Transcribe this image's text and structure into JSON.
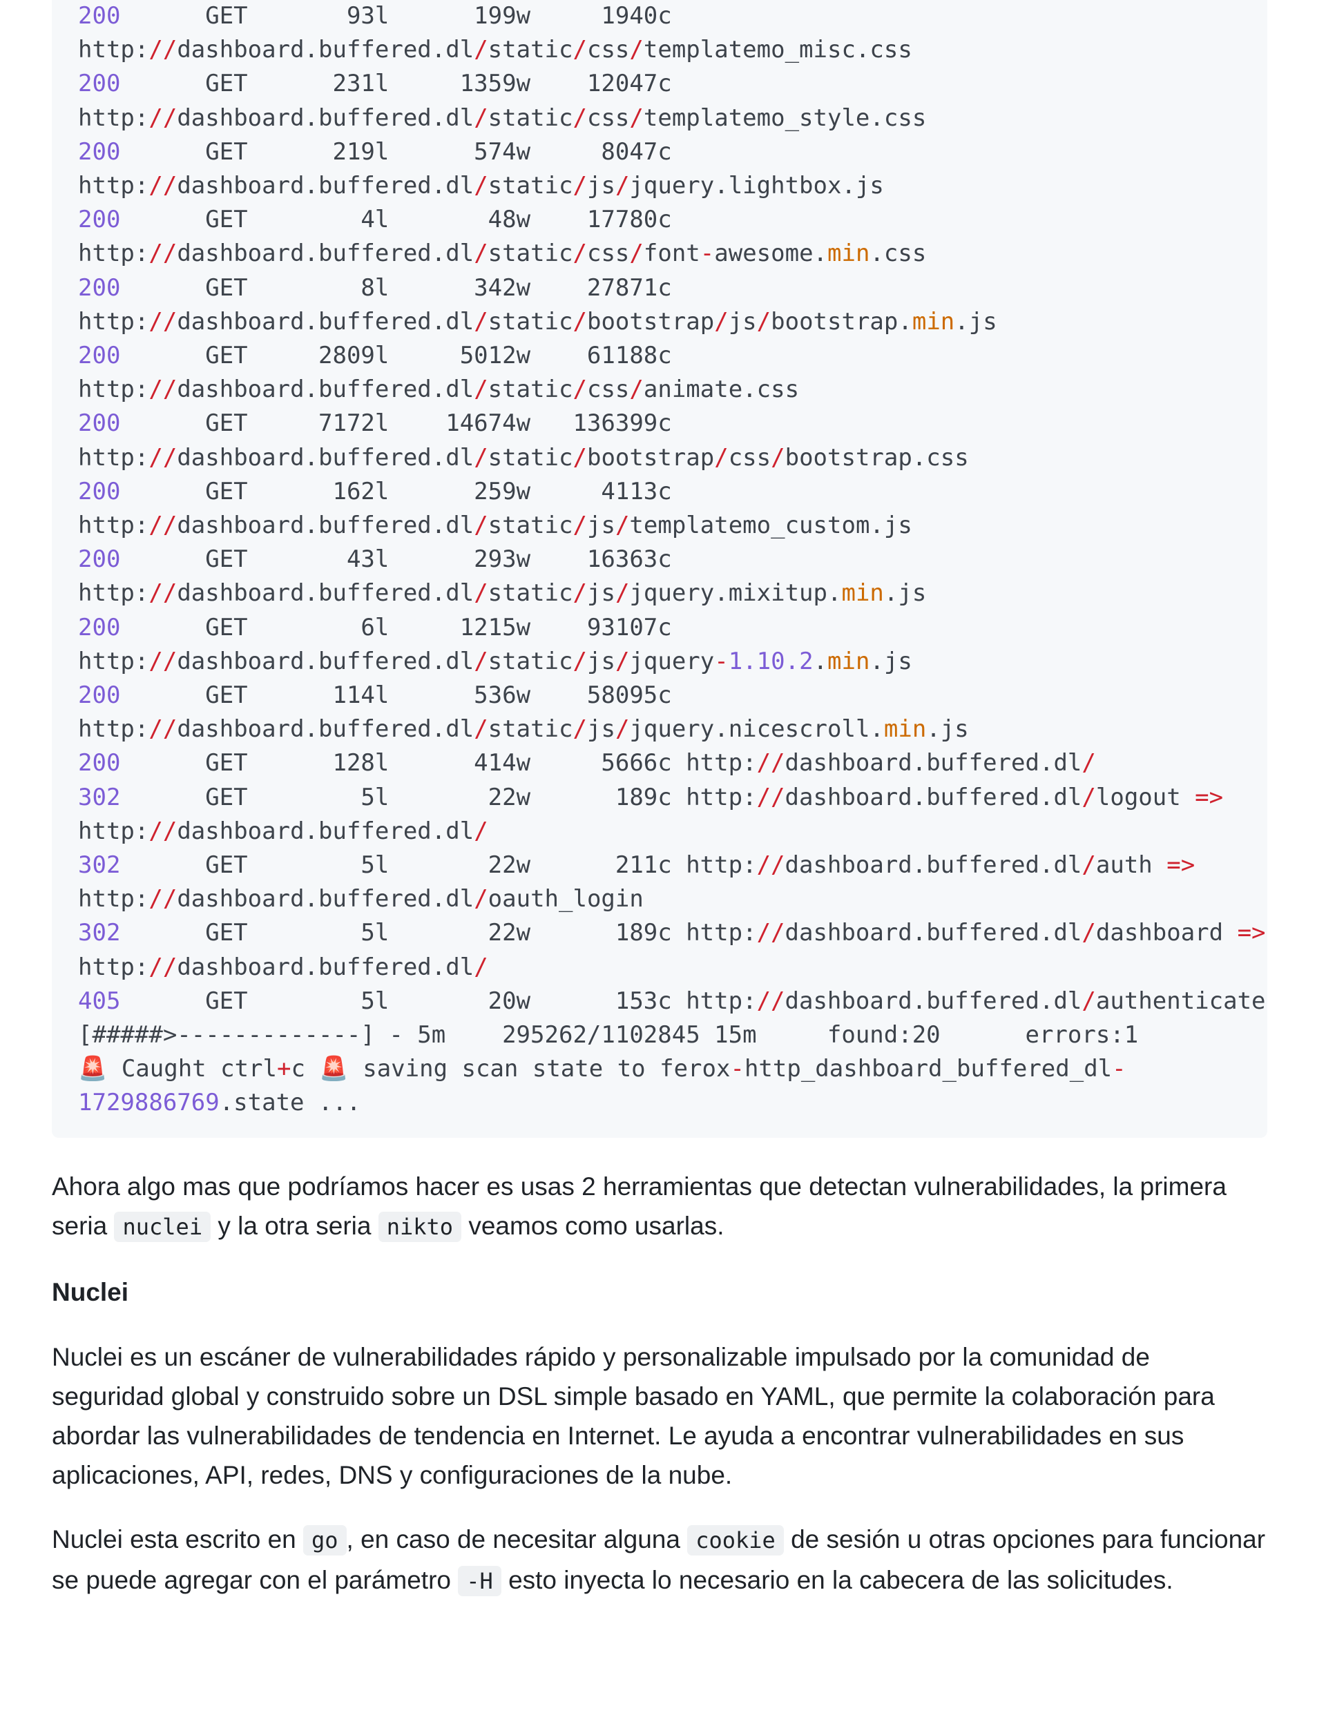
{
  "terminal_output": {
    "lines": [
      [
        {
          "t": "200",
          "c": "num"
        },
        {
          "t": "      GET       93l      199w     1940c"
        }
      ],
      [
        {
          "t": "http:"
        },
        {
          "t": "//",
          "c": "op"
        },
        {
          "t": "dashboard.buffered.dl"
        },
        {
          "t": "/",
          "c": "op"
        },
        {
          "t": "static"
        },
        {
          "t": "/",
          "c": "op"
        },
        {
          "t": "css"
        },
        {
          "t": "/",
          "c": "op"
        },
        {
          "t": "templatemo_misc.css"
        }
      ],
      [
        {
          "t": "200",
          "c": "num"
        },
        {
          "t": "      GET      231l     1359w    12047c"
        }
      ],
      [
        {
          "t": "http:"
        },
        {
          "t": "//",
          "c": "op"
        },
        {
          "t": "dashboard.buffered.dl"
        },
        {
          "t": "/",
          "c": "op"
        },
        {
          "t": "static"
        },
        {
          "t": "/",
          "c": "op"
        },
        {
          "t": "css"
        },
        {
          "t": "/",
          "c": "op"
        },
        {
          "t": "templatemo_style.css"
        }
      ],
      [
        {
          "t": "200",
          "c": "num"
        },
        {
          "t": "      GET      219l      574w     8047c"
        }
      ],
      [
        {
          "t": "http:"
        },
        {
          "t": "//",
          "c": "op"
        },
        {
          "t": "dashboard.buffered.dl"
        },
        {
          "t": "/",
          "c": "op"
        },
        {
          "t": "static"
        },
        {
          "t": "/",
          "c": "op"
        },
        {
          "t": "js"
        },
        {
          "t": "/",
          "c": "op"
        },
        {
          "t": "jquery.lightbox.js"
        }
      ],
      [
        {
          "t": "200",
          "c": "num"
        },
        {
          "t": "      GET        4l       48w    17780c"
        }
      ],
      [
        {
          "t": "http:"
        },
        {
          "t": "//",
          "c": "op"
        },
        {
          "t": "dashboard.buffered.dl"
        },
        {
          "t": "/",
          "c": "op"
        },
        {
          "t": "static"
        },
        {
          "t": "/",
          "c": "op"
        },
        {
          "t": "css"
        },
        {
          "t": "/",
          "c": "op"
        },
        {
          "t": "font"
        },
        {
          "t": "-",
          "c": "op"
        },
        {
          "t": "awesome."
        },
        {
          "t": "min",
          "c": "kw"
        },
        {
          "t": ".css"
        }
      ],
      [
        {
          "t": "200",
          "c": "num"
        },
        {
          "t": "      GET        8l      342w    27871c"
        }
      ],
      [
        {
          "t": "http:"
        },
        {
          "t": "//",
          "c": "op"
        },
        {
          "t": "dashboard.buffered.dl"
        },
        {
          "t": "/",
          "c": "op"
        },
        {
          "t": "static"
        },
        {
          "t": "/",
          "c": "op"
        },
        {
          "t": "bootstrap"
        },
        {
          "t": "/",
          "c": "op"
        },
        {
          "t": "js"
        },
        {
          "t": "/",
          "c": "op"
        },
        {
          "t": "bootstrap."
        },
        {
          "t": "min",
          "c": "kw"
        },
        {
          "t": ".js"
        }
      ],
      [
        {
          "t": "200",
          "c": "num"
        },
        {
          "t": "      GET     2809l     5012w    61188c"
        }
      ],
      [
        {
          "t": "http:"
        },
        {
          "t": "//",
          "c": "op"
        },
        {
          "t": "dashboard.buffered.dl"
        },
        {
          "t": "/",
          "c": "op"
        },
        {
          "t": "static"
        },
        {
          "t": "/",
          "c": "op"
        },
        {
          "t": "css"
        },
        {
          "t": "/",
          "c": "op"
        },
        {
          "t": "animate.css"
        }
      ],
      [
        {
          "t": "200",
          "c": "num"
        },
        {
          "t": "      GET     7172l    14674w   136399c"
        }
      ],
      [
        {
          "t": "http:"
        },
        {
          "t": "//",
          "c": "op"
        },
        {
          "t": "dashboard.buffered.dl"
        },
        {
          "t": "/",
          "c": "op"
        },
        {
          "t": "static"
        },
        {
          "t": "/",
          "c": "op"
        },
        {
          "t": "bootstrap"
        },
        {
          "t": "/",
          "c": "op"
        },
        {
          "t": "css"
        },
        {
          "t": "/",
          "c": "op"
        },
        {
          "t": "bootstrap.css"
        }
      ],
      [
        {
          "t": "200",
          "c": "num"
        },
        {
          "t": "      GET      162l      259w     4113c"
        }
      ],
      [
        {
          "t": "http:"
        },
        {
          "t": "//",
          "c": "op"
        },
        {
          "t": "dashboard.buffered.dl"
        },
        {
          "t": "/",
          "c": "op"
        },
        {
          "t": "static"
        },
        {
          "t": "/",
          "c": "op"
        },
        {
          "t": "js"
        },
        {
          "t": "/",
          "c": "op"
        },
        {
          "t": "templatemo_custom.js"
        }
      ],
      [
        {
          "t": "200",
          "c": "num"
        },
        {
          "t": "      GET       43l      293w    16363c"
        }
      ],
      [
        {
          "t": "http:"
        },
        {
          "t": "//",
          "c": "op"
        },
        {
          "t": "dashboard.buffered.dl"
        },
        {
          "t": "/",
          "c": "op"
        },
        {
          "t": "static"
        },
        {
          "t": "/",
          "c": "op"
        },
        {
          "t": "js"
        },
        {
          "t": "/",
          "c": "op"
        },
        {
          "t": "jquery.mixitup."
        },
        {
          "t": "min",
          "c": "kw"
        },
        {
          "t": ".js"
        }
      ],
      [
        {
          "t": "200",
          "c": "num"
        },
        {
          "t": "      GET        6l     1215w    93107c"
        }
      ],
      [
        {
          "t": "http:"
        },
        {
          "t": "//",
          "c": "op"
        },
        {
          "t": "dashboard.buffered.dl"
        },
        {
          "t": "/",
          "c": "op"
        },
        {
          "t": "static"
        },
        {
          "t": "/",
          "c": "op"
        },
        {
          "t": "js"
        },
        {
          "t": "/",
          "c": "op"
        },
        {
          "t": "jquery"
        },
        {
          "t": "-",
          "c": "op"
        },
        {
          "t": "1.10.2",
          "c": "num"
        },
        {
          "t": "."
        },
        {
          "t": "min",
          "c": "kw"
        },
        {
          "t": ".js"
        }
      ],
      [
        {
          "t": "200",
          "c": "num"
        },
        {
          "t": "      GET      114l      536w    58095c"
        }
      ],
      [
        {
          "t": "http:"
        },
        {
          "t": "//",
          "c": "op"
        },
        {
          "t": "dashboard.buffered.dl"
        },
        {
          "t": "/",
          "c": "op"
        },
        {
          "t": "static"
        },
        {
          "t": "/",
          "c": "op"
        },
        {
          "t": "js"
        },
        {
          "t": "/",
          "c": "op"
        },
        {
          "t": "jquery.nicescroll."
        },
        {
          "t": "min",
          "c": "kw"
        },
        {
          "t": ".js"
        }
      ],
      [
        {
          "t": "200",
          "c": "num"
        },
        {
          "t": "      GET      128l      414w     5666c http:"
        },
        {
          "t": "//",
          "c": "op"
        },
        {
          "t": "dashboard.buffered.dl"
        },
        {
          "t": "/",
          "c": "op"
        }
      ],
      [
        {
          "t": "302",
          "c": "num"
        },
        {
          "t": "      GET        5l       22w      189c http:"
        },
        {
          "t": "//",
          "c": "op"
        },
        {
          "t": "dashboard.buffered.dl"
        },
        {
          "t": "/",
          "c": "op"
        },
        {
          "t": "logout "
        },
        {
          "t": "=>",
          "c": "op"
        }
      ],
      [
        {
          "t": "http:"
        },
        {
          "t": "//",
          "c": "op"
        },
        {
          "t": "dashboard.buffered.dl"
        },
        {
          "t": "/",
          "c": "op"
        }
      ],
      [
        {
          "t": "302",
          "c": "num"
        },
        {
          "t": "      GET        5l       22w      211c http:"
        },
        {
          "t": "//",
          "c": "op"
        },
        {
          "t": "dashboard.buffered.dl"
        },
        {
          "t": "/",
          "c": "op"
        },
        {
          "t": "auth "
        },
        {
          "t": "=>",
          "c": "op"
        }
      ],
      [
        {
          "t": "http:"
        },
        {
          "t": "//",
          "c": "op"
        },
        {
          "t": "dashboard.buffered.dl"
        },
        {
          "t": "/",
          "c": "op"
        },
        {
          "t": "oauth_login"
        }
      ],
      [
        {
          "t": "302",
          "c": "num"
        },
        {
          "t": "      GET        5l       22w      189c http:"
        },
        {
          "t": "//",
          "c": "op"
        },
        {
          "t": "dashboard.buffered.dl"
        },
        {
          "t": "/",
          "c": "op"
        },
        {
          "t": "dashboard "
        },
        {
          "t": "=>",
          "c": "op"
        }
      ],
      [
        {
          "t": "http:"
        },
        {
          "t": "//",
          "c": "op"
        },
        {
          "t": "dashboard.buffered.dl"
        },
        {
          "t": "/",
          "c": "op"
        }
      ],
      [
        {
          "t": "405",
          "c": "num"
        },
        {
          "t": "      GET        5l       20w      153c http:"
        },
        {
          "t": "//",
          "c": "op"
        },
        {
          "t": "dashboard.buffered.dl"
        },
        {
          "t": "/",
          "c": "op"
        },
        {
          "t": "authenticate"
        }
      ],
      [
        {
          "t": "[#####>-------------] - 5m    295262/1102845 15m     found:20      errors:1"
        }
      ],
      [
        {
          "t": "🚨",
          "c": "alarm"
        },
        {
          "t": " Caught ctrl"
        },
        {
          "t": "+",
          "c": "op"
        },
        {
          "t": "c "
        },
        {
          "t": "🚨",
          "c": "alarm"
        },
        {
          "t": " saving scan state to ferox"
        },
        {
          "t": "-",
          "c": "op"
        },
        {
          "t": "http_dashboard_buffered_dl"
        },
        {
          "t": "-",
          "c": "op"
        }
      ],
      [
        {
          "t": "1729886769",
          "c": "num"
        },
        {
          "t": ".state ..."
        }
      ]
    ]
  },
  "intro_paragraph": {
    "before": "Ahora algo mas que podríamos hacer es usas 2 herramientas que detectan vulnerabilidades, la primera seria ",
    "tool1": "nuclei",
    "middle": " y la otra seria ",
    "tool2": "nikto",
    "after": " veamos como usarlas."
  },
  "section_heading": "Nuclei",
  "description_paragraph": "Nuclei es un escáner de vulnerabilidades rápido y personalizable impulsado por la comunidad de seguridad global y construido sobre un DSL simple basado en YAML, que permite la colaboración para abordar las vulnerabilidades de tendencia en Internet. Le ayuda a encontrar vulnerabilidades en sus aplicaciones, API, redes, DNS y configuraciones de la nube.",
  "usage_paragraph": {
    "p1": "Nuclei esta escrito en ",
    "code1": "go",
    "p2": ", en caso de necesitar alguna ",
    "code2": "cookie",
    "p3": " de sesión u otras opciones para funcionar se puede agregar con el parámetro ",
    "code3": "-H",
    "p4": " esto inyecta lo necesario en la cabecera de las solicitudes."
  }
}
